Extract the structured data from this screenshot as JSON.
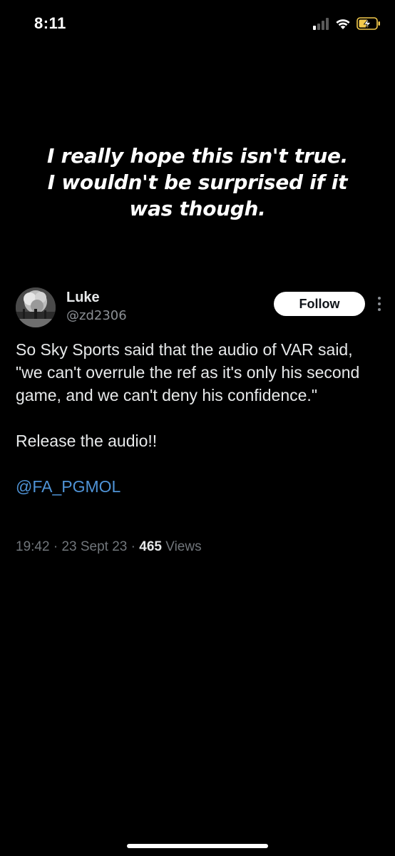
{
  "status_bar": {
    "time": "8:11",
    "icons": [
      "signal-icon",
      "wifi-icon",
      "battery-charging-icon"
    ],
    "battery_color": "#f2c94c"
  },
  "caption": {
    "text": "I really hope this isn't true. I wouldn't be surprised if it was though."
  },
  "tweet": {
    "author": {
      "name": "Luke",
      "handle": "@zd2306",
      "avatar_icon": "avatar-photo"
    },
    "follow_label": "Follow",
    "more_icon": "more-vertical-icon",
    "text": "So Sky Sports said that the audio of VAR said, \"we can't overrule the ref as it's only his second game, and we can't deny his confidence.\"",
    "cta": "Release the audio!!",
    "mention": "@FA_PGMOL",
    "meta": {
      "time": "19:42",
      "separator": "·",
      "date": "23 Sept 23",
      "views_count": "465",
      "views_label": "Views"
    }
  },
  "colors": {
    "background": "#000000",
    "text": "#e7e9ea",
    "muted": "#71767b",
    "link": "#4f93d6",
    "follow_bg": "#ffffff"
  }
}
